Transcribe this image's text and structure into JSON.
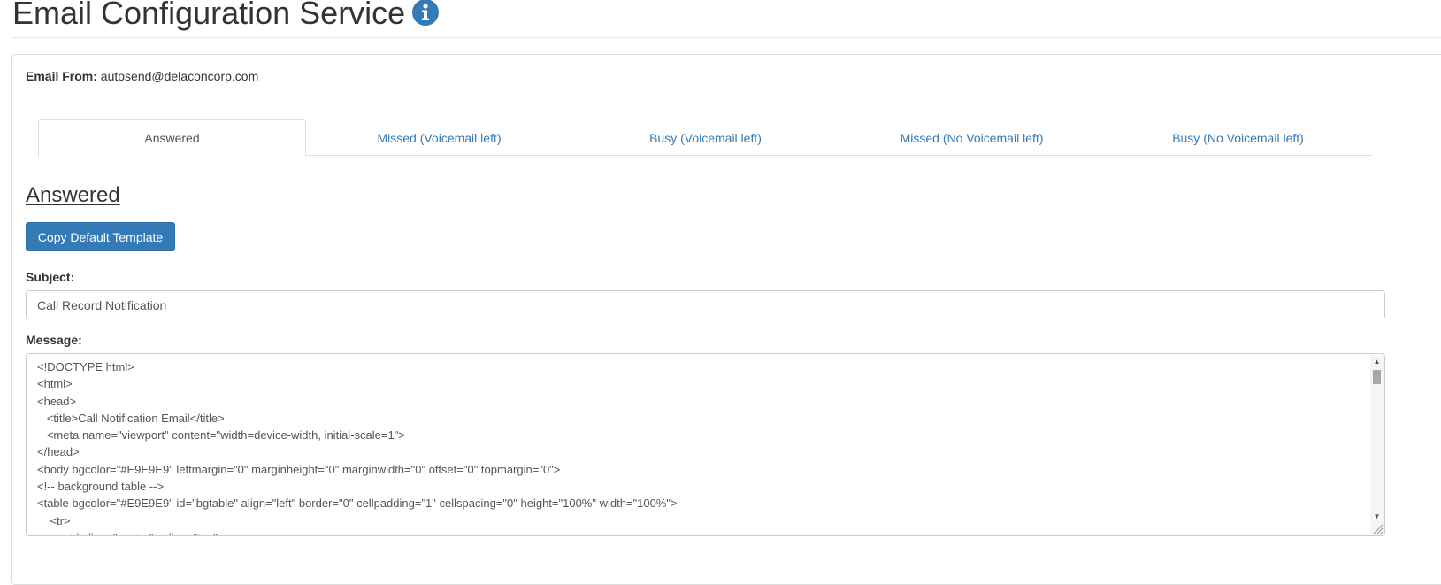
{
  "header": {
    "title": "Email Configuration Service",
    "info_icon": "info-circle-icon",
    "info_icon_color": "#337ab7"
  },
  "email_from": {
    "label": "Email From:",
    "value": "autosend@delaconcorp.com"
  },
  "tabs": [
    {
      "label": "Answered",
      "active": true
    },
    {
      "label": "Missed (Voicemail left)",
      "active": false
    },
    {
      "label": "Busy (Voicemail left)",
      "active": false
    },
    {
      "label": "Missed (No Voicemail left)",
      "active": false
    },
    {
      "label": "Busy (No Voicemail left)",
      "active": false
    }
  ],
  "section": {
    "title": "Answered",
    "copy_button_label": "Copy Default Template"
  },
  "subject": {
    "label": "Subject:",
    "value": "Call Record Notification"
  },
  "message": {
    "label": "Message:",
    "lines": [
      "<!DOCTYPE html>",
      "<html>",
      "<head>",
      "   <title>Call Notification Email</title>",
      "   <meta name=\"viewport\" content=\"width=device-width, initial-scale=1\">",
      "</head>",
      "<body bgcolor=\"#E9E9E9\" leftmargin=\"0\" marginheight=\"0\" marginwidth=\"0\" offset=\"0\" topmargin=\"0\">",
      "<!-- background table -->",
      "<table bgcolor=\"#E9E9E9\" id=\"bgtable\" align=\"left\" border=\"0\" cellpadding=\"1\" cellspacing=\"0\" height=\"100%\" width=\"100%\">",
      "    <tr>",
      "        <td align=\"center\" valign=\"top\">"
    ]
  },
  "colors": {
    "link": "#337ab7",
    "primary_button": "#337ab7",
    "text": "#333333",
    "border": "#dddddd"
  }
}
